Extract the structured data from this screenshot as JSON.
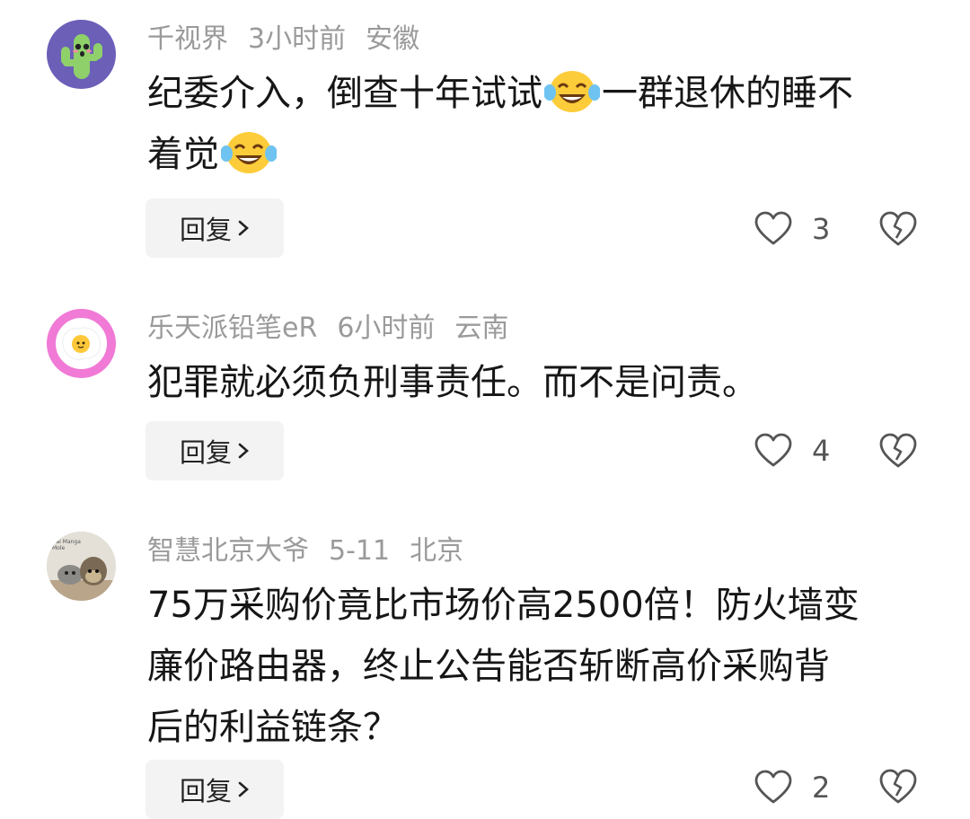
{
  "comments": [
    {
      "username": "千视界",
      "time": "3小时前",
      "location": "安徽",
      "text_parts": [
        "纪委介入，倒查十年试试",
        "一群退休的睡不",
        "着觉"
      ],
      "avatar_icon": "cactus-avatar",
      "reply_label": "回复",
      "likes": "3"
    },
    {
      "username": "乐天派铅笔eR",
      "time": "6小时前",
      "location": "云南",
      "text": "犯罪就必须负刑事责任。而不是问责。",
      "avatar_icon": "fried-egg-avatar",
      "reply_label": "回复",
      "likes": "4"
    },
    {
      "username": "智慧北京大爷",
      "time": "5-11",
      "location": "北京",
      "text_lines": [
        "75万采购价竟比市场价高2500倍！防火墙变",
        "廉价路由器，终止公告能否斩断高价采购背",
        "后的利益链条？"
      ],
      "avatar_icon": "toy-photo-avatar",
      "avatar_text": "Hai Manga Mole",
      "reply_label": "回复",
      "likes": "2"
    }
  ],
  "colors": {
    "meta_text": "#9a9a9a",
    "body_text": "#161616",
    "reply_bg": "#f3f3f3",
    "icon_stroke": "#555555"
  }
}
